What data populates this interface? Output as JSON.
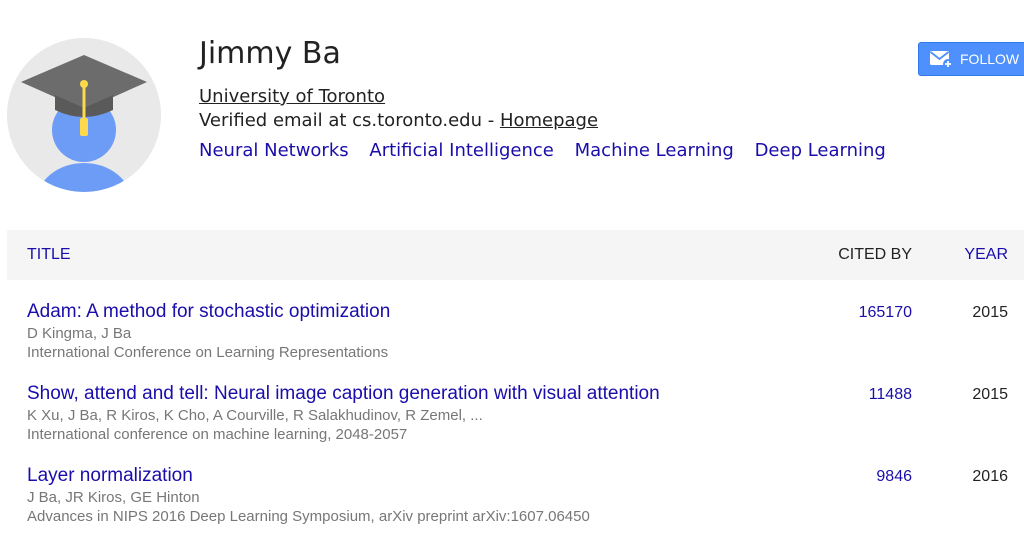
{
  "profile": {
    "name": "Jimmy Ba",
    "affiliation": "University of Toronto",
    "email_text": "Verified email at cs.toronto.edu - ",
    "homepage_label": "Homepage",
    "interests": [
      "Neural Networks",
      "Artificial Intelligence",
      "Machine Learning",
      "Deep Learning"
    ],
    "avatar_icon": "graduate-cap-avatar-icon"
  },
  "follow": {
    "label": "FOLLOW",
    "icon": "email-follow-icon"
  },
  "table": {
    "headers": {
      "title": "TITLE",
      "cited_by": "CITED BY",
      "year": "YEAR"
    },
    "rows": [
      {
        "title": "Adam: A method for stochastic optimization",
        "authors": "D Kingma, J Ba",
        "venue": "International Conference on Learning Representations",
        "cited_by": "165170",
        "year": "2015"
      },
      {
        "title": "Show, attend and tell: Neural image caption generation with visual attention",
        "authors": "K Xu, J Ba, R Kiros, K Cho, A Courville, R Salakhudinov, R Zemel, ...",
        "venue": "International conference on machine learning, 2048-2057",
        "cited_by": "11488",
        "year": "2015"
      },
      {
        "title": "Layer normalization",
        "authors": "J Ba, JR Kiros, GE Hinton",
        "venue": "Advances in NIPS 2016 Deep Learning Symposium, arXiv preprint arXiv:1607.06450",
        "cited_by": "9846",
        "year": "2016"
      }
    ]
  },
  "colors": {
    "link": "#1a0dab",
    "follow_button": "#4d90fe",
    "header_bg": "#f5f5f5",
    "avatar_body": "#6d9cf7",
    "cap": "#6c6c6c",
    "tassel": "#fdd94b"
  }
}
